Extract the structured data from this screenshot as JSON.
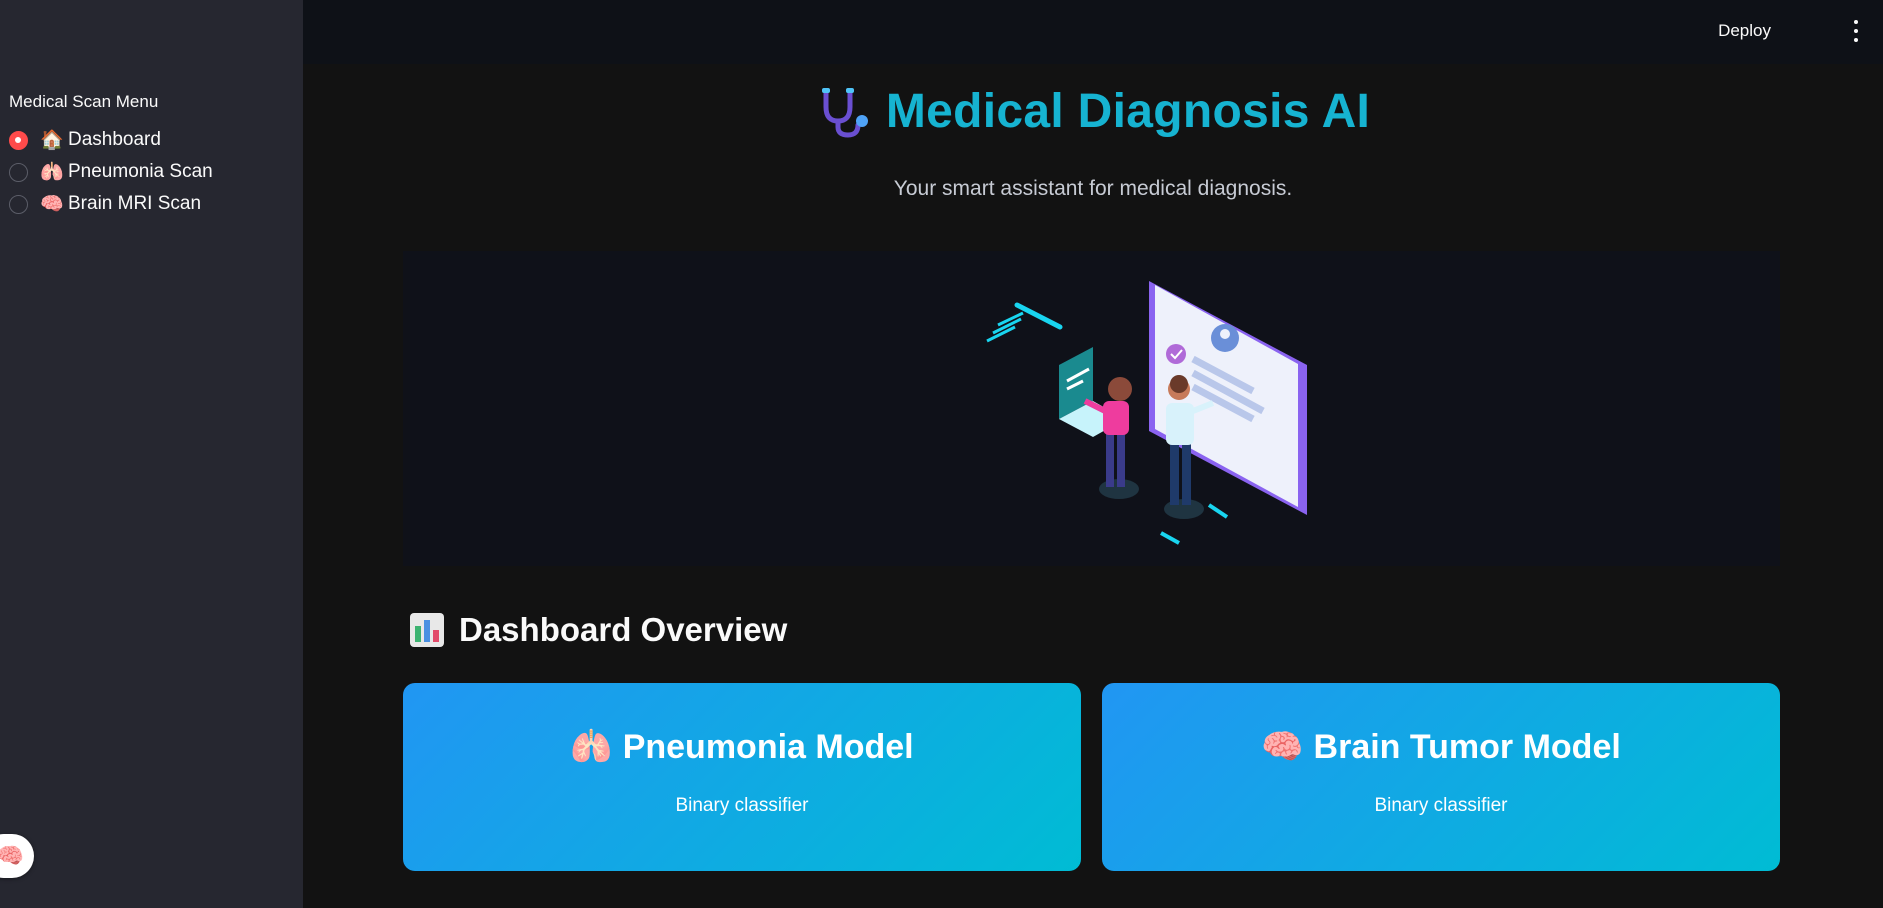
{
  "sidebar": {
    "title": "Medical Scan Menu",
    "items": [
      {
        "emoji": "🏠",
        "label": "Dashboard",
        "selected": true
      },
      {
        "emoji": "🫁",
        "label": "Pneumonia Scan",
        "selected": false
      },
      {
        "emoji": "🧠",
        "label": "Brain MRI Scan",
        "selected": false
      }
    ],
    "fab_icon": "🧠"
  },
  "header": {
    "deploy_label": "Deploy",
    "menu_icon": "kebab-menu-icon"
  },
  "main": {
    "title_icon": "stethoscope-icon",
    "title": "Medical Diagnosis AI",
    "subtitle": "Your smart assistant for medical diagnosis.",
    "hero_image": "medical-consultation-illustration",
    "section_icon": "bar-chart-icon",
    "section_title": "Dashboard Overview",
    "cards": [
      {
        "emoji": "🫁",
        "title": "Pneumonia Model",
        "description": "Binary classifier"
      },
      {
        "emoji": "🧠",
        "title": "Brain Tumor Model",
        "description": "Binary classifier"
      }
    ]
  },
  "colors": {
    "accent": "#ff4b4b",
    "title": "#16b3d1",
    "card_gradient_start": "#2196f3",
    "card_gradient_end": "#00bcd4",
    "sidebar_bg": "#262730",
    "main_bg": "#121212"
  }
}
